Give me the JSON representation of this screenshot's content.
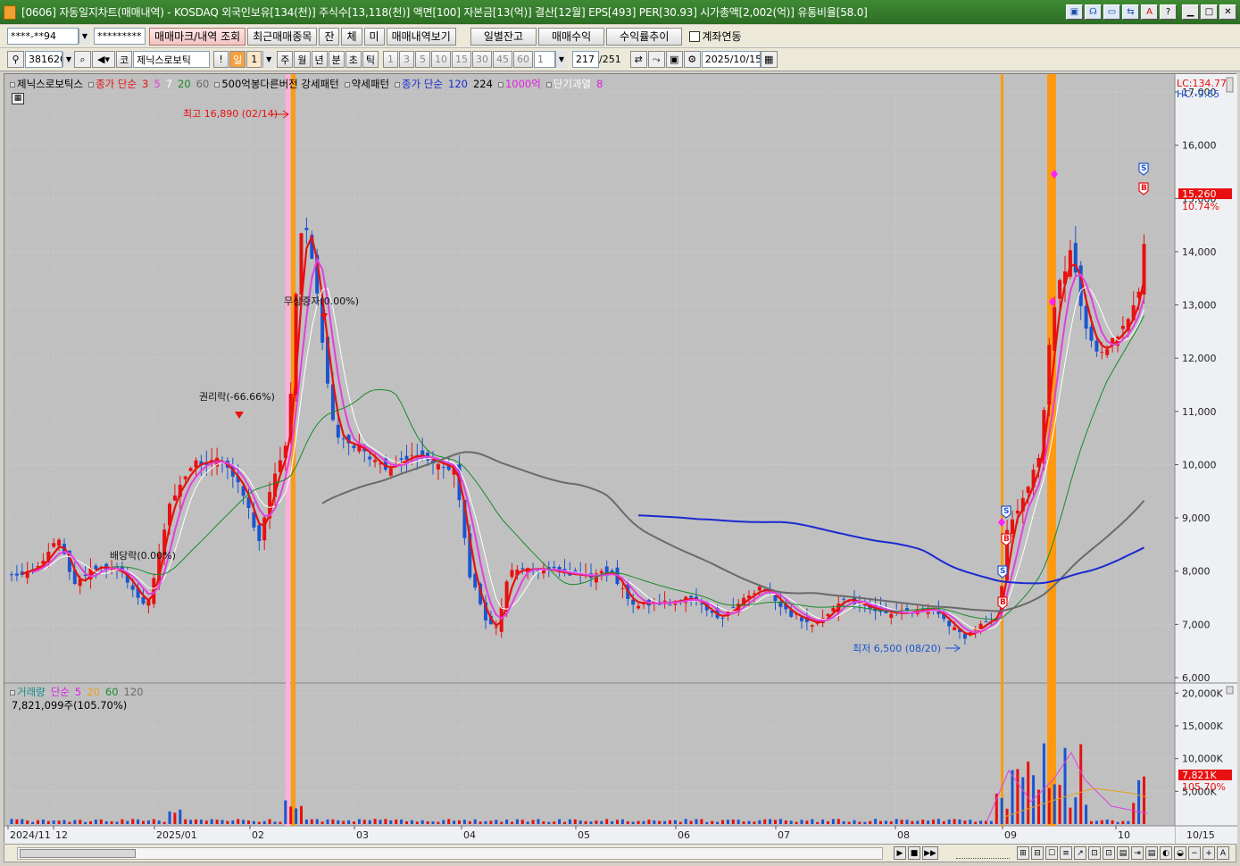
{
  "window": {
    "title": "[0606] 자동일지차트(매매내역) - KOSDAQ 외국인보유[134(천)] 주식수[13,118(천)] 액면[100] 자본금[13(억)] 결산[12월] EPS[493] PER[30.93] 시가총액[2,002(억)] 유통비율[58.0]",
    "buttons": [
      "▣",
      "☊",
      "▭",
      "⇆",
      "A",
      "?",
      "▁",
      "□",
      "✕"
    ]
  },
  "toolbar1": {
    "account": "****-**94",
    "password": "*********",
    "buttons": [
      "매매마크/내역 조회",
      "최근매매종목",
      "잔",
      "체",
      "미",
      "매매내역보기"
    ],
    "wide_buttons": [
      "일별잔고",
      "매매수익",
      "수익률추이"
    ],
    "checkbox_label": "계좌연동"
  },
  "toolbar2": {
    "code": "381620",
    "market_btn": "코",
    "stock_name": "제닉스로보틱",
    "warn": "!",
    "period": [
      "일",
      "1"
    ],
    "period_buttons": [
      "주",
      "월",
      "년",
      "분",
      "초",
      "틱"
    ],
    "num_buttons": [
      "1",
      "3",
      "5",
      "10",
      "15",
      "30",
      "45",
      "60"
    ],
    "count_input": "1",
    "count_value": "217",
    "count_total": "/251",
    "date": "2025/10/15"
  },
  "price_legend": {
    "name": "제닉스로보틱스",
    "ma_label": "종가 단순",
    "ma_periods": [
      "3",
      "5",
      "7",
      "20",
      "60"
    ],
    "pattern1": "500억봉다른버전 강세패턴",
    "pattern2": "약세패턴",
    "ma2_label": "종가 단순",
    "ma2_periods": [
      "120",
      "224"
    ],
    "extra1": "1000억",
    "extra2": "단기과열",
    "extra2_val": "8"
  },
  "volume_legend": {
    "label": "거래량",
    "ma_label": "단순",
    "ma_periods": [
      "5",
      "20",
      "60",
      "120"
    ],
    "value": "7,821,099주(105.70%)"
  },
  "corner": {
    "lc": "LC:134.77",
    "hc": "HC:-9.65"
  },
  "annotations": {
    "high": "최고 16,890 (02/14)",
    "low": "최저 6,500 (08/20)",
    "bonus": "무상증자(0.00%)",
    "rights": "권리락(-66.66%)",
    "dividend": "배당락(0.00%)"
  },
  "price_tag": {
    "price": "15,260",
    "pct": "10.74%"
  },
  "vol_tag": {
    "value": "7,821K",
    "pct": "105.70%"
  },
  "colors": {
    "up": "#e81010",
    "down": "#1a55d0",
    "ma5": "#e040e0",
    "ma20": "#1a8a2a",
    "ma60": "#6a6a6a",
    "ma120": "#1a2ad0",
    "ma224": "#000000",
    "highlight": "#ff9a10",
    "pink": "#ffb0d8"
  },
  "chart_data": [
    {
      "type": "candlestick",
      "title": "제닉스로보틱스",
      "y_ticks": [
        "17,000",
        "16,000",
        "15,000",
        "14,000",
        "13,000",
        "12,000",
        "11,000",
        "10,000",
        "9,000",
        "8,000",
        "7,000",
        "6,000"
      ],
      "ylim": [
        6000,
        17000
      ],
      "x_ticks": [
        "2024/11",
        "12",
        "2025/01",
        "02",
        "03",
        "04",
        "05",
        "06",
        "07",
        "08",
        "09",
        "10",
        "10/15"
      ],
      "series_close": [
        {
          "date": "2024/11",
          "value": 7900
        },
        {
          "date": "2024/12",
          "value": 8200
        },
        {
          "date": "2025/01",
          "value": 9600
        },
        {
          "date": "2025/01b",
          "value": 10100
        },
        {
          "date": "2025/02",
          "value": 8600
        },
        {
          "date": "2025/02/14",
          "value": 14500
        },
        {
          "date": "2025/03",
          "value": 10500
        },
        {
          "date": "2025/04",
          "value": 7000
        },
        {
          "date": "2025/05",
          "value": 8000
        },
        {
          "date": "2025/06",
          "value": 7400
        },
        {
          "date": "2025/07",
          "value": 7300
        },
        {
          "date": "2025/08",
          "value": 6700
        },
        {
          "date": "2025/09",
          "value": 12500
        },
        {
          "date": "2025/10",
          "value": 15260
        }
      ],
      "high": 16890,
      "low": 6500,
      "last": 15260
    },
    {
      "type": "bar",
      "title": "거래량",
      "y_ticks": [
        "20,000K",
        "15,000K",
        "10,000K",
        "5,000K"
      ],
      "ylim": [
        0,
        21000
      ],
      "last_volume_k": 7821
    }
  ],
  "bottombar": {
    "buttons": [
      "▶",
      "■",
      "▶▶"
    ],
    "icons": [
      "⊞",
      "⊟",
      "☐",
      "≡",
      "↗",
      "⊡",
      "⊡",
      "▤",
      "⇥",
      "▤",
      "◐",
      "◒",
      "−",
      "+",
      "A"
    ]
  }
}
